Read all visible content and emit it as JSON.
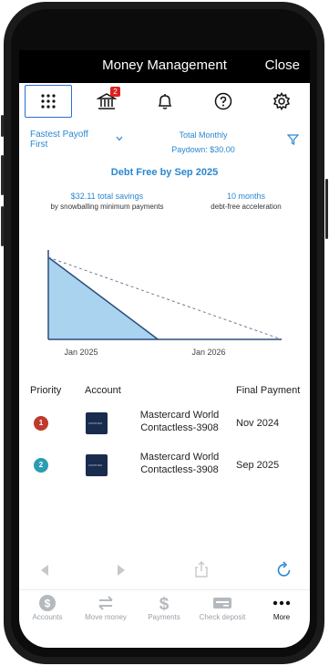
{
  "header": {
    "title": "Money Management",
    "close_label": "Close"
  },
  "toolbar": {
    "icons": [
      "grid-icon",
      "bank-icon",
      "bell-icon",
      "help-icon",
      "gear-icon"
    ],
    "bank_badge": "2"
  },
  "plan": {
    "strategy_line1": "Fastest Payoff",
    "strategy_line2": "First",
    "monthly_label": "Total Monthly",
    "paydown_label": "Paydown:",
    "paydown_value": "$30.00"
  },
  "summary": {
    "headline": "Debt Free by Sep 2025",
    "savings": "$32.11 total savings",
    "savings_sub": "by snowballing minimum payments",
    "months": "10 months",
    "months_sub": "debt-free acceleration"
  },
  "chart_data": {
    "type": "area",
    "x_ticks": [
      "Jan 2025",
      "Jan 2026"
    ],
    "series": [
      {
        "values": [
          100,
          50,
          0,
          0
        ],
        "style": "filled"
      },
      {
        "values": [
          100,
          67,
          33,
          0
        ],
        "style": "dashed"
      }
    ],
    "colors": {
      "fill": "#a9d3ef",
      "line": "#2e4c7c",
      "dash": "#6b7a93"
    },
    "grid": false
  },
  "table": {
    "headers": [
      "Priority",
      "Account",
      "Final Payment"
    ],
    "rows": [
      {
        "priority": "1",
        "account_line1": "Mastercard World",
        "account_line2": "Contactless-3908",
        "final_payment": "Nov 2024",
        "card_text": "CONTOSO",
        "color": "#c0392b"
      },
      {
        "priority": "2",
        "account_line1": "Mastercard World",
        "account_line2": "Contactless-3908",
        "final_payment": "Sep 2025",
        "card_text": "CONTOSO",
        "color": "#2a9db3"
      }
    ]
  },
  "browser_nav": {
    "icons": [
      "back-icon",
      "forward-icon",
      "share-icon",
      "reload-icon"
    ]
  },
  "tabbar": {
    "tabs": [
      {
        "label": "Accounts",
        "icon": "dollar-circle-icon"
      },
      {
        "label": "Move money",
        "icon": "transfer-icon"
      },
      {
        "label": "Payments",
        "icon": "dollar-icon"
      },
      {
        "label": "Check deposit",
        "icon": "check-icon"
      },
      {
        "label": "More",
        "icon": "more-icon"
      }
    ]
  }
}
